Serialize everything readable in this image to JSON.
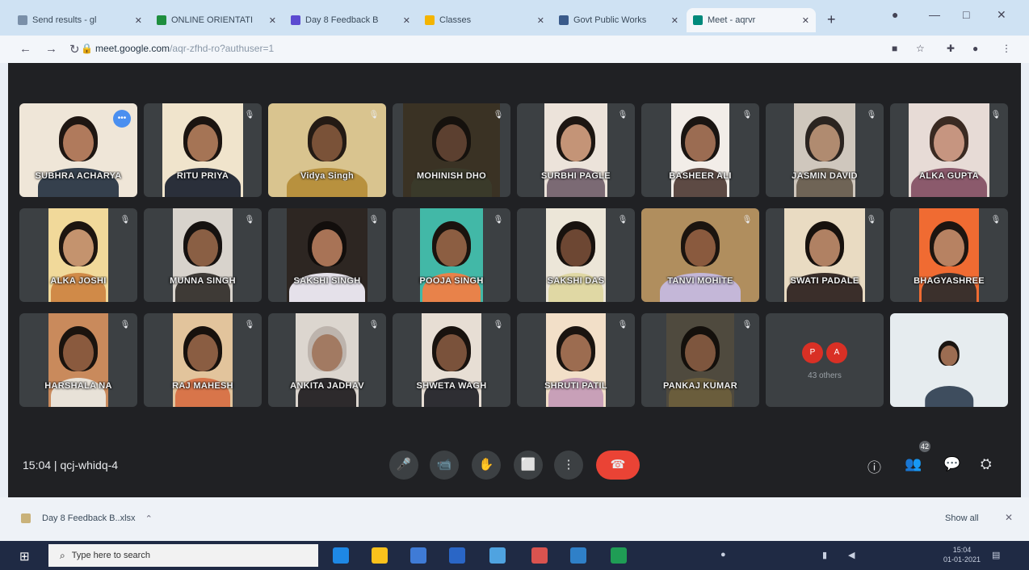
{
  "browser": {
    "tabs": [
      {
        "label": "Send results - gl",
        "icon_color": "#7a8fa8",
        "active": false
      },
      {
        "label": "ONLINE ORIENTATI",
        "icon_color": "#1e8e3e",
        "active": false
      },
      {
        "label": "Day 8 Feedback B",
        "icon_color": "#5b4ad1",
        "active": false
      },
      {
        "label": "Classes",
        "icon_color": "#f4b400",
        "active": false
      },
      {
        "label": "Govt Public Works",
        "icon_color": "#3a5a8a",
        "active": false
      },
      {
        "label": "Meet - aqrvr",
        "icon_color": "#00897b",
        "active": true
      }
    ],
    "new_tab_icon": "plus-icon",
    "url_host": "meet.google.com",
    "url_path": "/aqr-zfhd-ro?authuser=1"
  },
  "meeting": {
    "time": "15:04",
    "code": "qcj-whidq-4",
    "participant_count": "42",
    "others_label": "43 others",
    "others_initials": [
      "P",
      "A"
    ],
    "rows": [
      [
        {
          "name": "SUBHRA ACHARYA",
          "bg": "#efe6d8",
          "skin": "#b07a5c",
          "hair": "#1e1612",
          "cloth": "#35404d",
          "w": 146,
          "speaking": true
        },
        {
          "name": "RITU PRIYA",
          "bg": "#f0e4cc",
          "skin": "#a57455",
          "hair": "#1b1410",
          "cloth": "#2a2f3a",
          "w": 100
        },
        {
          "name": "Vidya Singh",
          "bg": "#d9c48f",
          "skin": "#7a5238",
          "hair": "#231a14",
          "cloth": "#b8913e",
          "w": 146
        },
        {
          "name": "MOHINISH DHO",
          "bg": "#3a3224",
          "skin": "#5c4030",
          "hair": "#15110d",
          "cloth": "#3a3a2a",
          "w": 120
        },
        {
          "name": "SURBHI PAGLE",
          "bg": "#ece3da",
          "skin": "#c49477",
          "hair": "#1d1612",
          "cloth": "#7b6a74",
          "w": 78
        },
        {
          "name": "BASHEER ALI",
          "bg": "#f2ede8",
          "skin": "#9b6c52",
          "hair": "#1a1512",
          "cloth": "#5d4a44",
          "w": 72
        },
        {
          "name": "JASMIN DAVID",
          "bg": "#cfc7bd",
          "skin": "#b08b70",
          "hair": "#2b2420",
          "cloth": "#6f6456",
          "w": 76
        },
        {
          "name": "ALKA GUPTA",
          "bg": "#e7dbd6",
          "skin": "#c69580",
          "hair": "#3a2a22",
          "cloth": "#8b5a6c",
          "w": 100
        }
      ],
      [
        {
          "name": "ALKA JOSHI",
          "bg": "#f1d99a",
          "skin": "#c4936e",
          "hair": "#1d1510",
          "cloth": "#d08a48",
          "w": 74
        },
        {
          "name": "MUNNA SINGH",
          "bg": "#d8d3cc",
          "skin": "#8a5f44",
          "hair": "#161210",
          "cloth": "#3e3a36",
          "w": 74
        },
        {
          "name": "SAKSHI SINGH",
          "bg": "#2d2622",
          "skin": "#a87356",
          "hair": "#120e0c",
          "cloth": "#e5e1ea",
          "w": 100
        },
        {
          "name": "POOJA SINGH",
          "bg": "#42b8a7",
          "skin": "#8c5e42",
          "hair": "#1a130e",
          "cloth": "#e8824a",
          "w": 78
        },
        {
          "name": "SAKSHI DAS",
          "bg": "#ece6d8",
          "skin": "#6d4733",
          "hair": "#18120e",
          "cloth": "#e0d8a4",
          "w": 74
        },
        {
          "name": "TANVI MOHITE",
          "bg": "#b08e5e",
          "skin": "#8a5a3e",
          "hair": "#1b140f",
          "cloth": "#c4b7d8",
          "w": 146
        },
        {
          "name": "SWATI PADALE",
          "bg": "#e9dbc2",
          "skin": "#b08163",
          "hair": "#17110d",
          "cloth": "#3a2e2a",
          "w": 100
        },
        {
          "name": "BHAGYASHREE",
          "bg": "#f06b32",
          "skin": "#b78262",
          "hair": "#1d1510",
          "cloth": "#3b302c",
          "w": 74
        }
      ],
      [
        {
          "name": "HARSHALA NA",
          "bg": "#c98a5c",
          "skin": "#8a5a3e",
          "hair": "#1a130e",
          "cloth": "#e8e2d8",
          "w": 74
        },
        {
          "name": "RAJ MAHESH",
          "bg": "#e2c49c",
          "skin": "#8a5d42",
          "hair": "#17110d",
          "cloth": "#d8754a",
          "w": 74
        },
        {
          "name": "ANKITA JADHAV",
          "bg": "#dcd6cf",
          "skin": "#a27a62",
          "hair": "#bdb4ad",
          "cloth": "#2d2a2c",
          "w": 78
        },
        {
          "name": "SHWETA WAGH",
          "bg": "#e7ded4",
          "skin": "#7a523b",
          "hair": "#18120e",
          "cloth": "#2e2e33",
          "w": 74
        },
        {
          "name": "SHRUTI PATIL",
          "bg": "#f2dfc8",
          "skin": "#9c6c50",
          "hair": "#1a1410",
          "cloth": "#c8a0b8",
          "w": 74
        },
        {
          "name": "PANKAJ KUMAR",
          "bg": "#4f4a3e",
          "skin": "#7e563e",
          "hair": "#14100c",
          "cloth": "#6a5d3c",
          "w": 84
        },
        {
          "others": true
        },
        {
          "name": "",
          "bg": "#e6ecef",
          "skin": "#9c6d52",
          "hair": "#1a1410",
          "cloth": "#3e4d5e",
          "w": 146,
          "room": true
        }
      ]
    ],
    "controls": [
      {
        "name": "mic-icon",
        "glyph": "🎤"
      },
      {
        "name": "camera-icon",
        "glyph": "📹"
      },
      {
        "name": "raise-hand-icon",
        "glyph": "✋"
      },
      {
        "name": "present-screen-icon",
        "glyph": "⬜"
      },
      {
        "name": "more-options-icon",
        "glyph": "⋮"
      },
      {
        "name": "end-call-icon",
        "glyph": "☎"
      }
    ],
    "right_controls": [
      {
        "name": "meeting-info-icon",
        "glyph": "ⓘ"
      },
      {
        "name": "people-icon",
        "glyph": "👥"
      },
      {
        "name": "chat-icon",
        "glyph": "💬"
      },
      {
        "name": "activities-icon",
        "glyph": "⛭"
      }
    ],
    "mic_off_glyph": "🎙",
    "speaking_glyph": "•••"
  },
  "downloads": {
    "file": "Day 8 Feedback B..xlsx",
    "show_all": "Show all"
  },
  "taskbar": {
    "search_placeholder": "Type here to search",
    "apps": [
      "#1e88e5",
      "#f9c11c",
      "#3f7bd6",
      "#2a66c6",
      "#4fa3e0",
      "#d9534f",
      "#2f80c8",
      "#1f9d55"
    ],
    "clock_time": "15:04",
    "clock_date": "01-01-2021"
  }
}
